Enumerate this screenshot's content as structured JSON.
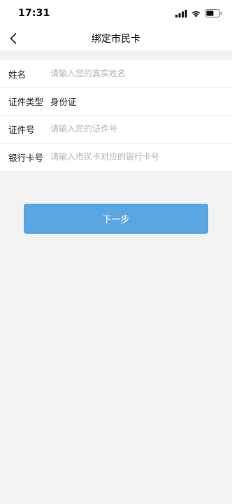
{
  "status_bar": {
    "time": "17:31",
    "icons": [
      "cellular-signal-icon",
      "wifi-icon",
      "battery-icon"
    ]
  },
  "nav": {
    "back_icon": "chevron-left-icon",
    "title": "绑定市民卡"
  },
  "form": {
    "name": {
      "label": "姓名",
      "placeholder": "请输入您的真实姓名",
      "value": ""
    },
    "id_type": {
      "label": "证件类型",
      "value": "身份证"
    },
    "id_number": {
      "label": "证件号",
      "placeholder": "请输入您的证件号",
      "value": ""
    },
    "bank_card": {
      "label": "银行卡号",
      "placeholder": "请输入市民卡对应的银行卡号",
      "value": ""
    }
  },
  "next_button": {
    "label": "下一步"
  },
  "colors": {
    "primary": "#5aa6e2",
    "background": "#f2f2f2",
    "surface": "#ffffff",
    "placeholder": "#b5b5b5"
  }
}
